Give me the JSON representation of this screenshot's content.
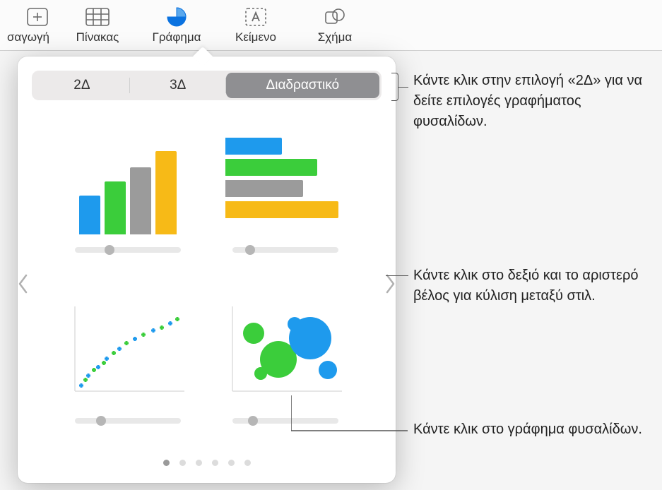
{
  "toolbar": {
    "items": [
      {
        "label": "σαγωγή",
        "icon": "insert"
      },
      {
        "label": "Πίνακας",
        "icon": "table"
      },
      {
        "label": "Γράφημα",
        "icon": "chart"
      },
      {
        "label": "Κείμενο",
        "icon": "text"
      },
      {
        "label": "Σχήμα",
        "icon": "shape"
      }
    ]
  },
  "popover": {
    "tabs": [
      "2Δ",
      "3Δ",
      "Διαδραστικό"
    ],
    "selected_tab": "Διαδραστικό",
    "page_count": 6,
    "active_page": 0,
    "charts": [
      {
        "type": "bar-vertical"
      },
      {
        "type": "bar-horizontal"
      },
      {
        "type": "scatter"
      },
      {
        "type": "bubble"
      }
    ]
  },
  "callouts": {
    "tabs": "Κάντε κλικ στην επιλογή «2Δ» για να δείτε επιλογές γραφήματος φυσαλίδων.",
    "arrows": "Κάντε κλικ στο δεξιό και το αριστερό βέλος για κύλιση μεταξύ στιλ.",
    "bubble": "Κάντε κλικ στο γράφημα φυσαλίδων."
  },
  "colors": {
    "blue": "#1e9aed",
    "green": "#3bcd3b",
    "gray": "#9b9b9b",
    "yellow": "#f7ba17"
  }
}
